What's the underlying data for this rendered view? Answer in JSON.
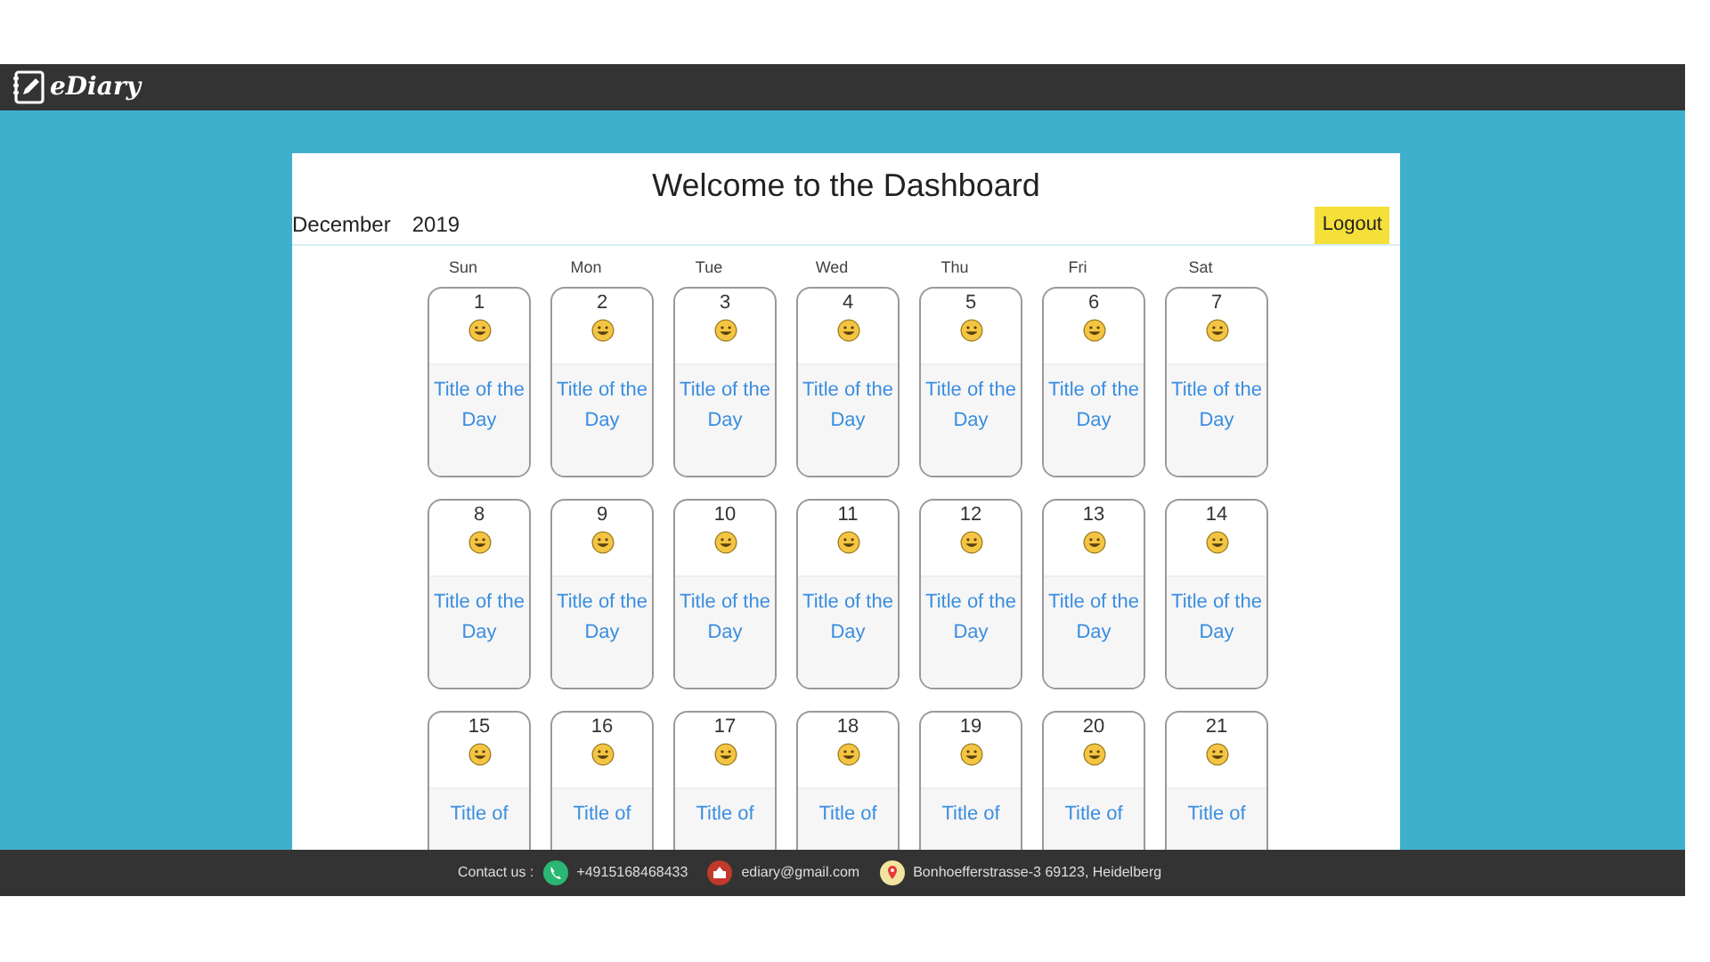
{
  "navbar": {
    "brand": "eDiary"
  },
  "dashboard": {
    "title": "Welcome to the Dashboard",
    "month": "December",
    "year": "2019",
    "logout": "Logout"
  },
  "weekdays": [
    "Sun",
    "Mon",
    "Tue",
    "Wed",
    "Thu",
    "Fri",
    "Sat"
  ],
  "weeks": [
    [
      {
        "day": "1",
        "title": "Title of the Day"
      },
      {
        "day": "2",
        "title": "Title of the Day"
      },
      {
        "day": "3",
        "title": "Title of the Day"
      },
      {
        "day": "4",
        "title": "Title of the Day"
      },
      {
        "day": "5",
        "title": "Title of the Day"
      },
      {
        "day": "6",
        "title": "Title of the Day"
      },
      {
        "day": "7",
        "title": "Title of the Day"
      }
    ],
    [
      {
        "day": "8",
        "title": "Title of the Day"
      },
      {
        "day": "9",
        "title": "Title of the Day"
      },
      {
        "day": "10",
        "title": "Title of the Day"
      },
      {
        "day": "11",
        "title": "Title of the Day"
      },
      {
        "day": "12",
        "title": "Title of the Day"
      },
      {
        "day": "13",
        "title": "Title of the Day"
      },
      {
        "day": "14",
        "title": "Title of the Day"
      }
    ],
    [
      {
        "day": "15",
        "title": "Title of"
      },
      {
        "day": "16",
        "title": "Title of"
      },
      {
        "day": "17",
        "title": "Title of"
      },
      {
        "day": "18",
        "title": "Title of"
      },
      {
        "day": "19",
        "title": "Title of"
      },
      {
        "day": "20",
        "title": "Title of"
      },
      {
        "day": "21",
        "title": "Title of"
      }
    ]
  ],
  "footer": {
    "label": "Contact us :",
    "phone": "+4915168468433",
    "email": "ediary@gmail.com",
    "address": "Bonhoefferstrasse-3 69123, Heidelberg"
  }
}
